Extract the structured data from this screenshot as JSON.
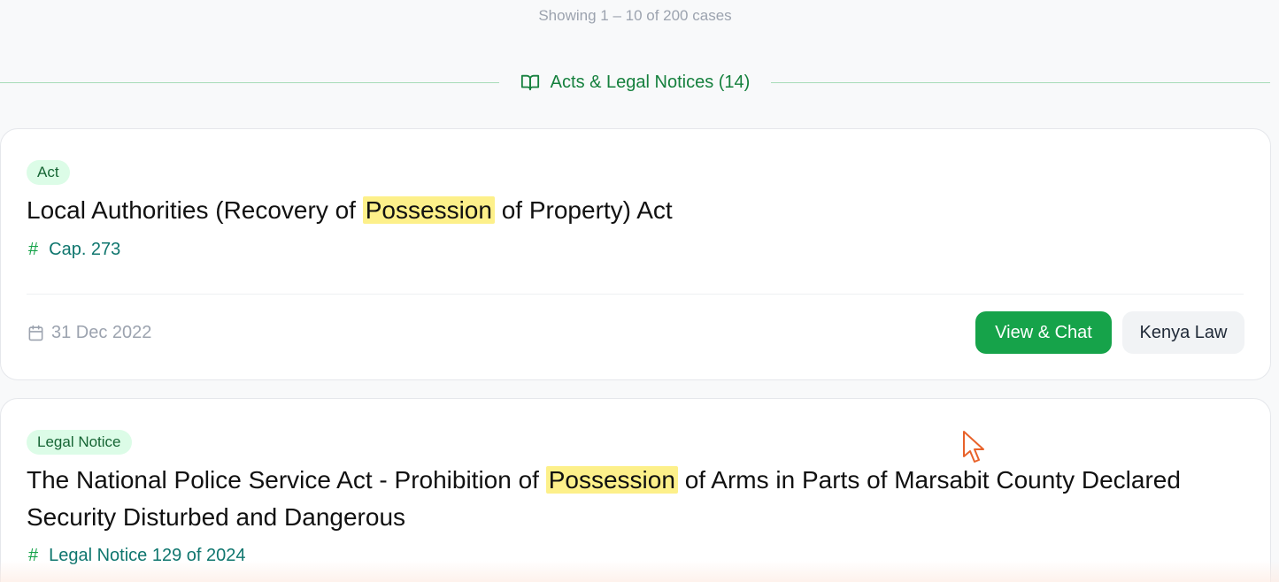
{
  "results": {
    "showing_text": "Showing 1 – 10 of 200 cases"
  },
  "section": {
    "icon": "book-open-icon",
    "label": "Acts & Legal Notices (14)"
  },
  "cards": [
    {
      "badge": "Act",
      "title_before": "Local Authorities (Recovery of ",
      "title_highlight": "Possession",
      "title_after": " of Property) Act",
      "ref": "Cap. 273",
      "date": "31 Dec 2022",
      "primary_label": "View & Chat",
      "source_label": "Kenya Law"
    },
    {
      "badge": "Legal Notice",
      "title_before": "The National Police Service Act - Prohibition of ",
      "title_highlight": "Possession",
      "title_after": " of Arms in Parts of Marsabit County Declared Security Disturbed and Dangerous",
      "ref": "Legal Notice 129 of 2024"
    }
  ],
  "colors": {
    "accent": "#16a34a",
    "highlight": "#fdf08a",
    "badge_bg": "#dcfce7"
  }
}
